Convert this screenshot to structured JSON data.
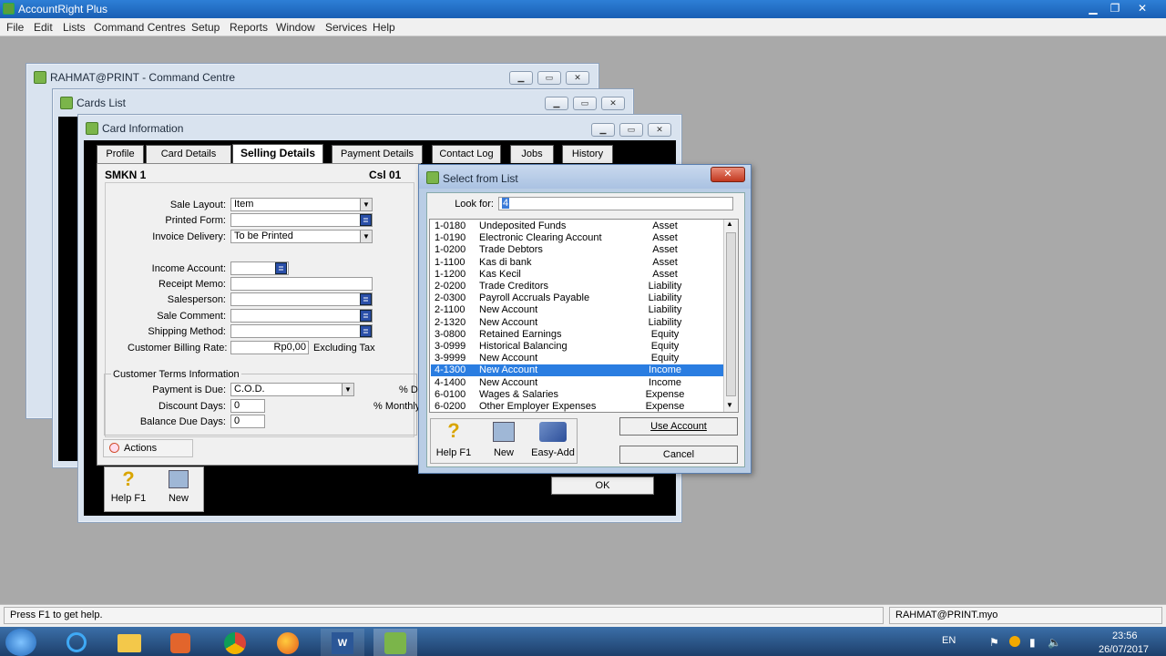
{
  "app": {
    "title": "AccountRight Plus"
  },
  "menu": [
    "File",
    "Edit",
    "Lists",
    "Command Centres",
    "Setup",
    "Reports",
    "Window",
    "Services",
    "Help"
  ],
  "windows": {
    "command_centre": "RAHMAT@PRINT - Command Centre",
    "cards_list": "Cards List",
    "card_info": "Card Information"
  },
  "tabs": [
    "Profile",
    "Card Details",
    "Selling Details",
    "Payment Details",
    "Contact Log",
    "Jobs",
    "History"
  ],
  "card": {
    "name": "SMKN 1",
    "code": "Csl 01"
  },
  "form": {
    "sale_layout_label": "Sale Layout:",
    "sale_layout": "Item",
    "printed_form_label": "Printed Form:",
    "printed_form": "",
    "invoice_delivery_label": "Invoice Delivery:",
    "invoice_delivery": "To be Printed",
    "income_account_label": "Income Account:",
    "income_account": "",
    "receipt_memo_label": "Receipt Memo:",
    "salesperson_label": "Salesperson:",
    "sale_comment_label": "Sale Comment:",
    "shipping_method_label": "Shipping Method:",
    "billing_rate_label": "Customer Billing Rate:",
    "billing_rate": "Rp0,00",
    "excluding_tax": "Excluding Tax",
    "terms_group": "Customer Terms Information",
    "payment_due_label": "Payment is Due:",
    "payment_due": "C.O.D.",
    "discount_days_label": "Discount Days:",
    "discount_days": "0",
    "balance_due_label": "Balance Due Days:",
    "balance_due": "0",
    "pct_d": "% D",
    "pct_monthly": "% Monthly"
  },
  "actions_label": "Actions",
  "bottom_buttons": {
    "help": "Help F1",
    "new": "New",
    "ok": "OK"
  },
  "select_dialog": {
    "title": "Select from List",
    "look_for_label": "Look for:",
    "look_for_value": "4",
    "accounts": [
      {
        "code": "1-0180",
        "name": "Undeposited Funds",
        "type": "Asset"
      },
      {
        "code": "1-0190",
        "name": "Electronic Clearing Account",
        "type": "Asset"
      },
      {
        "code": "1-0200",
        "name": "Trade Debtors",
        "type": "Asset"
      },
      {
        "code": "1-1100",
        "name": "Kas di bank",
        "type": "Asset"
      },
      {
        "code": "1-1200",
        "name": "Kas Kecil",
        "type": "Asset"
      },
      {
        "code": "2-0200",
        "name": "Trade Creditors",
        "type": "Liability"
      },
      {
        "code": "2-0300",
        "name": "Payroll Accruals Payable",
        "type": "Liability"
      },
      {
        "code": "2-1100",
        "name": "New Account",
        "type": "Liability"
      },
      {
        "code": "2-1320",
        "name": "New Account",
        "type": "Liability"
      },
      {
        "code": "3-0800",
        "name": "Retained Earnings",
        "type": "Equity"
      },
      {
        "code": "3-0999",
        "name": "Historical Balancing",
        "type": "Equity"
      },
      {
        "code": "3-9999",
        "name": "New Account",
        "type": "Equity"
      },
      {
        "code": "4-1300",
        "name": "New Account",
        "type": "Income",
        "selected": true
      },
      {
        "code": "4-1400",
        "name": "New Account",
        "type": "Income"
      },
      {
        "code": "6-0100",
        "name": "Wages & Salaries",
        "type": "Expense"
      },
      {
        "code": "6-0200",
        "name": "Other Employer Expenses",
        "type": "Expense"
      }
    ],
    "buttons": {
      "help": "Help F1",
      "new": "New",
      "easy_add": "Easy-Add",
      "use_account": "Use Account",
      "cancel": "Cancel"
    }
  },
  "status": {
    "help": "Press F1 to get help.",
    "file": "RAHMAT@PRINT.myo"
  },
  "tray": {
    "lang": "EN",
    "time": "23:56",
    "date": "26/07/2017"
  },
  "colors": {
    "selection": "#2a7de1",
    "titlebar": "#1a5fb4"
  }
}
